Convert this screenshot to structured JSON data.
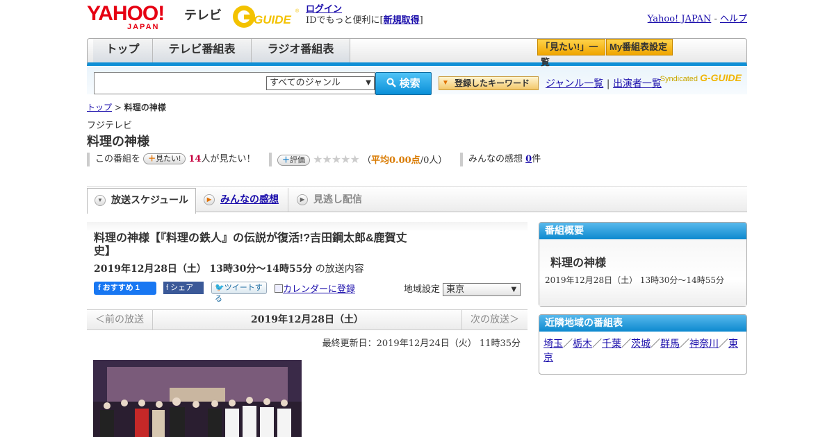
{
  "header": {
    "yahoo_logo": "YAHOO!",
    "yahoo_logo_sub": "JAPAN",
    "tv_label": "テレビ",
    "gguide_logo": "G-GUIDE",
    "login": "ログイン",
    "id_text": "IDでもっと便利に[",
    "signup": "新規取得",
    "id_text_end": "]",
    "yahoo_japan_link": "Yahoo! JAPAN",
    "separator": "-",
    "help_link": "ヘルプ"
  },
  "nav": {
    "tabs": [
      {
        "label": "トップ"
      },
      {
        "label": "テレビ番組表"
      },
      {
        "label": "ラジオ番組表"
      }
    ],
    "want_list_button": "「見たい!」一覧",
    "my_schedule_button": "My番組表設定"
  },
  "search": {
    "input_value": "",
    "genre_selected": "すべてのジャンル",
    "search_button": "検索",
    "keyword_button": "登録したキーワード",
    "genre_list_link": "ジャンル一覧",
    "divider": "|",
    "performer_list_link": "出演者一覧",
    "syndicated": "Syndicated",
    "syndicated_logo": "G-GUIDE"
  },
  "breadcrumb": {
    "top": "トップ",
    "sep": ">",
    "current": "料理の神様"
  },
  "program": {
    "channel": "フジテレビ",
    "title": "料理の神様"
  },
  "rating": {
    "prefix": "この番組を",
    "want_button": "見たい!",
    "want_count": "14",
    "want_suffix": "人が見たい！",
    "rate_button": "評価",
    "stars": "★★★★★",
    "avg_open": "（",
    "avg_label": "平均0.00点",
    "avg_people": "/0人）",
    "reviews_label": "みんなの感想",
    "reviews_count": "0",
    "reviews_suffix": "件"
  },
  "tabs": [
    {
      "label": "放送スケジュール"
    },
    {
      "label": "みんなの感想"
    },
    {
      "label": "見逃し配信"
    }
  ],
  "episode": {
    "title": "料理の神様【『料理の鉄人』の伝説が復活!?吉田鋼太郎&鹿賀丈史】",
    "date": "2019年12月28日（土）",
    "time": "13時30分～14時55分",
    "date_suffix": "の放送内容",
    "fb_recommend": "おすすめ 1",
    "fb_share": "シェア",
    "tweet": "ツイートする",
    "calendar": "カレンダーに登録",
    "region_label": "地域設定",
    "region_value": "東京"
  },
  "pager": {
    "prev": "＜前の放送",
    "current": "2019年12月28日（土）",
    "next": "次の放送＞"
  },
  "updated": "最終更新日：2019年12月24日（火） 11時35分",
  "sidebar": {
    "summary_head": "番組概要",
    "summary_title": "料理の神様",
    "summary_time": "2019年12月28日（土） 13時30分～14時55分",
    "nearby_head": "近隣地域の番組表",
    "regions": [
      "埼玉",
      "栃木",
      "千葉",
      "茨城",
      "群馬",
      "神奈川",
      "東京"
    ],
    "region_sep": "／"
  },
  "colors": {
    "accent_blue": "#0d89cf",
    "yahoo_red": "#e60012",
    "want_count_red": "#c5003e",
    "avg_orange": "#d97a00"
  }
}
